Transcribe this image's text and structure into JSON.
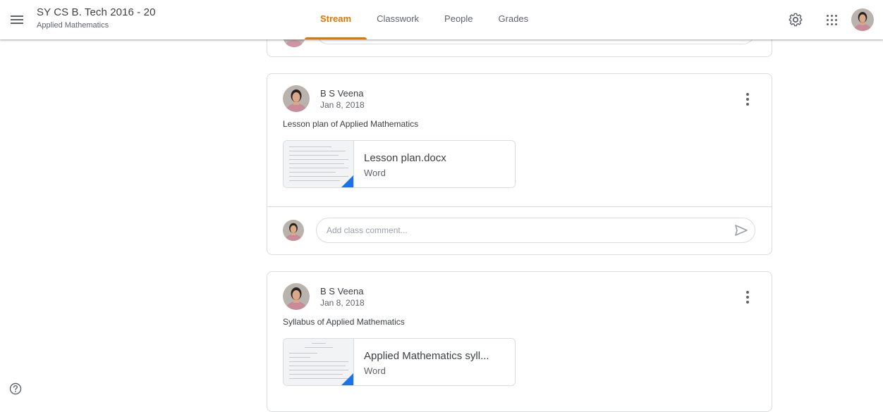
{
  "header": {
    "class_title": "SY CS B. Tech 2016 - 20",
    "class_subtitle": "Applied Mathematics",
    "tabs": [
      {
        "label": "Stream",
        "active": true
      },
      {
        "label": "Classwork",
        "active": false
      },
      {
        "label": "People",
        "active": false
      },
      {
        "label": "Grades",
        "active": false
      }
    ],
    "icons": [
      "menu-icon",
      "settings-gear-icon",
      "apps-grid-icon",
      "profile-avatar"
    ]
  },
  "posts": [
    {
      "author": "B S Veena",
      "date": "Jan 8, 2018",
      "text": "Lesson plan of Applied Mathematics",
      "attachment": {
        "name": "Lesson plan.docx",
        "type": "Word"
      },
      "comment_placeholder": "Add class comment..."
    },
    {
      "author": "B S Veena",
      "date": "Jan 8, 2018",
      "text": "Syllabus of Applied Mathematics",
      "attachment": {
        "name": "Applied Mathematics syll...",
        "type": "Word"
      }
    }
  ],
  "colors": {
    "accent": "#e37400",
    "border": "#dadce0",
    "text": "#3c4043",
    "secondary_text": "#5f6368",
    "word_corner": "#1a73e8"
  }
}
